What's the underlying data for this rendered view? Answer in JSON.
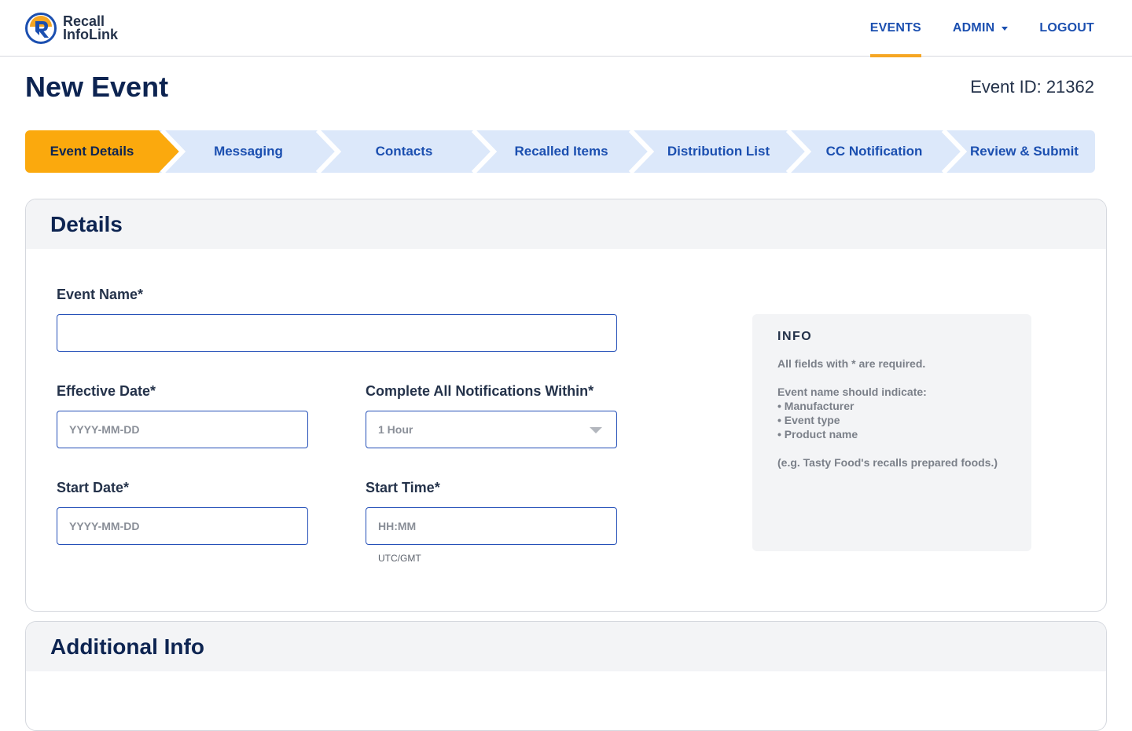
{
  "brand": {
    "line1": "Recall",
    "line2": "InfoLink",
    "colors": {
      "primary": "#1b4fb0",
      "accent": "#f6a623",
      "navy": "#0d2451"
    }
  },
  "nav": {
    "events": "EVENTS",
    "admin": "ADMIN",
    "logout": "LOGOUT"
  },
  "page": {
    "title": "New Event",
    "event_id": "Event ID: 21362"
  },
  "steps": [
    {
      "label": "Event Details"
    },
    {
      "label": "Messaging"
    },
    {
      "label": "Contacts"
    },
    {
      "label": "Recalled Items"
    },
    {
      "label": "Distribution List"
    },
    {
      "label": "CC Notification"
    },
    {
      "label": "Review & Submit"
    }
  ],
  "details": {
    "heading": "Details",
    "event_name": {
      "label": "Event Name*",
      "value": ""
    },
    "effective_date": {
      "label": "Effective Date*",
      "placeholder": "YYYY-MM-DD"
    },
    "complete_within": {
      "label": "Complete All Notifications Within*",
      "selected": "1 Hour"
    },
    "start_date": {
      "label": "Start Date*",
      "placeholder": "YYYY-MM-DD"
    },
    "start_time": {
      "label": "Start Time*",
      "placeholder": "HH:MM",
      "hint": "UTC/GMT"
    }
  },
  "info": {
    "title": "INFO",
    "required": "All  fields with * are required.",
    "indicate": "Event name should indicate:",
    "bullets": [
      "• Manufacturer",
      "• Event type",
      "• Product name"
    ],
    "example": "(e.g. Tasty Food's recalls prepared foods.)"
  },
  "additional": {
    "heading": "Additional Info"
  }
}
